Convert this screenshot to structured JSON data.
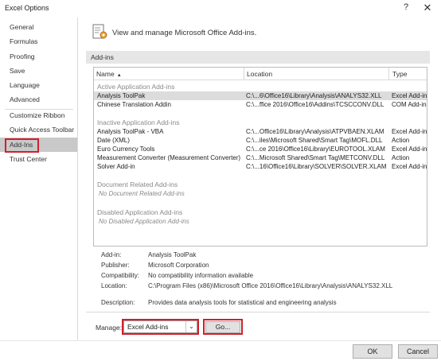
{
  "window": {
    "title": "Excel Options",
    "help_glyph": "?",
    "close_glyph": "✕"
  },
  "sidebar": {
    "items": [
      {
        "label": "General"
      },
      {
        "label": "Formulas"
      },
      {
        "label": "Proofing"
      },
      {
        "label": "Save"
      },
      {
        "label": "Language"
      },
      {
        "label": "Advanced"
      },
      {
        "label": "Customize Ribbon"
      },
      {
        "label": "Quick Access Toolbar"
      },
      {
        "label": "Add-Ins"
      },
      {
        "label": "Trust Center"
      }
    ],
    "selected": "Add-Ins"
  },
  "header": {
    "icon": "add-ins-gear-icon",
    "text": "View and manage Microsoft Office Add-ins."
  },
  "section_title": "Add-ins",
  "grid": {
    "columns": {
      "name": "Name",
      "name_sort": "▲",
      "location": "Location",
      "type": "Type"
    },
    "groups": {
      "active": {
        "title": "Active Application Add-ins",
        "rows": [
          {
            "name": "Analysis ToolPak",
            "location": "C:\\...6\\Office16\\Library\\Analysis\\ANALYS32.XLL",
            "type": "Excel Add-in"
          },
          {
            "name": "Chinese Translation Addin",
            "location": "C:\\...ffice 2016\\Office16\\Addins\\TCSCCONV.DLL",
            "type": "COM Add-in"
          }
        ]
      },
      "inactive": {
        "title": "Inactive Application Add-ins",
        "rows": [
          {
            "name": "Analysis ToolPak - VBA",
            "location": "C:\\...Office16\\Library\\Analysis\\ATPVBAEN.XLAM",
            "type": "Excel Add-in"
          },
          {
            "name": "Date (XML)",
            "location": "C:\\...iles\\Microsoft Shared\\Smart Tag\\MOFL.DLL",
            "type": "Action"
          },
          {
            "name": "Euro Currency Tools",
            "location": "C:\\...ce 2016\\Office16\\Library\\EUROTOOL.XLAM",
            "type": "Excel Add-in"
          },
          {
            "name": "Measurement Converter (Measurement Converter)",
            "location": "C:\\...Microsoft Shared\\Smart Tag\\METCONV.DLL",
            "type": "Action"
          },
          {
            "name": "Solver Add-in",
            "location": "C:\\...16\\Office16\\Library\\SOLVER\\SOLVER.XLAM",
            "type": "Excel Add-in"
          }
        ]
      },
      "document": {
        "title": "Document Related Add-ins",
        "empty": "No Document Related Add-ins"
      },
      "disabled": {
        "title": "Disabled Application Add-ins",
        "empty": "No Disabled Application Add-ins"
      }
    }
  },
  "details": {
    "addin_label": "Add-in:",
    "addin_value": "Analysis ToolPak",
    "publisher_label": "Publisher:",
    "publisher_value": "Microsoft Corporation",
    "compat_label": "Compatibility:",
    "compat_value": "No compatibility information available",
    "location_label": "Location:",
    "location_value": "C:\\Program Files (x86)\\Microsoft Office 2016\\Office16\\Library\\Analysis\\ANALYS32.XLL",
    "description_label": "Description:",
    "description_value": "Provides data analysis tools for statistical and engineering analysis"
  },
  "manage": {
    "label": "Manage:",
    "selected": "Excel Add-ins",
    "arrow_glyph": "⌄",
    "go_label": "Go..."
  },
  "footer": {
    "ok_label": "OK",
    "cancel_label": "Cancel"
  },
  "colors": {
    "highlight_box": "#d0202b",
    "selected_nav": "#c9c9c9",
    "group_heading": "#8a8a8a",
    "section_bar": "#e6e6e6"
  }
}
